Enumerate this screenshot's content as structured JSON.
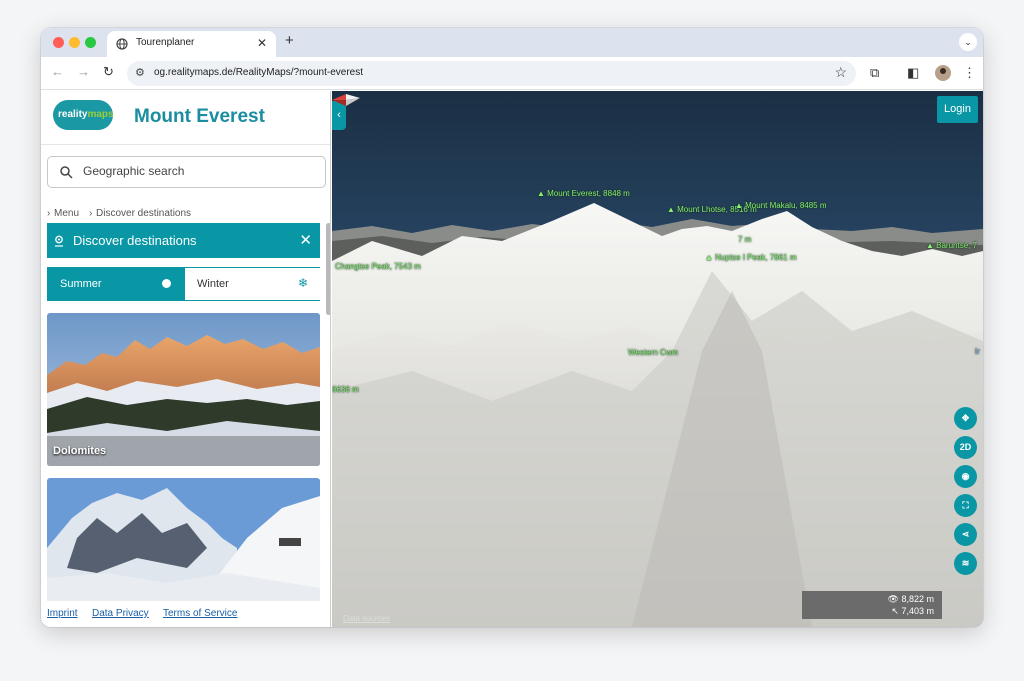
{
  "browser": {
    "tab_title": "Tourenplaner",
    "url": "og.realitymaps.de/RealityMaps/?mount-everest",
    "new_tab": "+",
    "tab_close": "✕"
  },
  "sidebar": {
    "logo": {
      "part1": "reality",
      "part2": "maps"
    },
    "title": "Mount Everest",
    "search_placeholder": "Geographic search",
    "breadcrumb": [
      "Menu",
      "Discover destinations"
    ],
    "section_title": "Discover destinations",
    "season": {
      "summer": "Summer",
      "winter": "Winter",
      "selected": "Summer"
    },
    "cards": [
      {
        "name": "Dolomites"
      },
      {
        "name": ""
      }
    ],
    "footer_links": [
      "Imprint",
      "Data Privacy",
      "Terms of Service"
    ]
  },
  "map": {
    "login": "Login",
    "peaks": [
      {
        "label": "Mount Everest, 8848 m"
      },
      {
        "label": "Mount Lhotse, 8516 m"
      },
      {
        "label": "Mount Makalu, 8485 m"
      },
      {
        "label": "Baruntse, 7"
      },
      {
        "label": "Changtse Peak, 7543 m"
      },
      {
        "label": "Nuptse I Peak, 7861 m"
      },
      {
        "label": "7 m"
      },
      {
        "label": "Western Cwm"
      },
      {
        "label": "6636 m"
      },
      {
        "label": "Ir"
      }
    ],
    "controls": [
      "move-icon",
      "2D",
      "eye-icon",
      "fullscreen-icon",
      "share-icon",
      "layers-icon"
    ],
    "view_altitude": "8,822 m",
    "cursor_altitude": "7,403 m",
    "data_sources": "Data sources",
    "colors": {
      "accent": "#0a97a5",
      "peak_label": "#8af07a"
    }
  }
}
